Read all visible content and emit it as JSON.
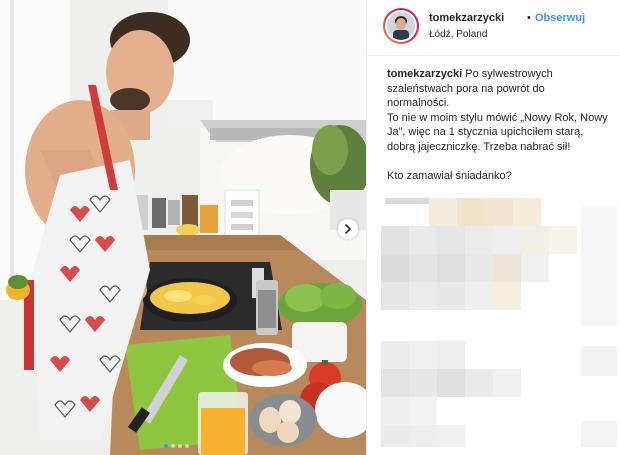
{
  "post": {
    "username": "tomekzarzycki",
    "separator": "•",
    "follow_label": "Obserwuj",
    "location": "Łódź, Poland",
    "caption_user": "tomekzarzycki",
    "caption_para1": "Po sylwestrowych szaleństwach pora na powrót do normalności.",
    "caption_para2": "To nie w moim stylu mówić „Nowy Rok, Nowy Ja”, więc na 1 stycznia upichciłem starą, dobrą jajeczniczkę. Trzeba nabrać sił!",
    "caption_para3": "Kto zamawiał śniadanko?"
  },
  "carousel": {
    "slide_count": 4,
    "active_index": 0,
    "next_icon": "chevron-right-icon"
  },
  "colors": {
    "link_blue": "#3897f0",
    "text": "#262626",
    "divider": "#efefef"
  }
}
